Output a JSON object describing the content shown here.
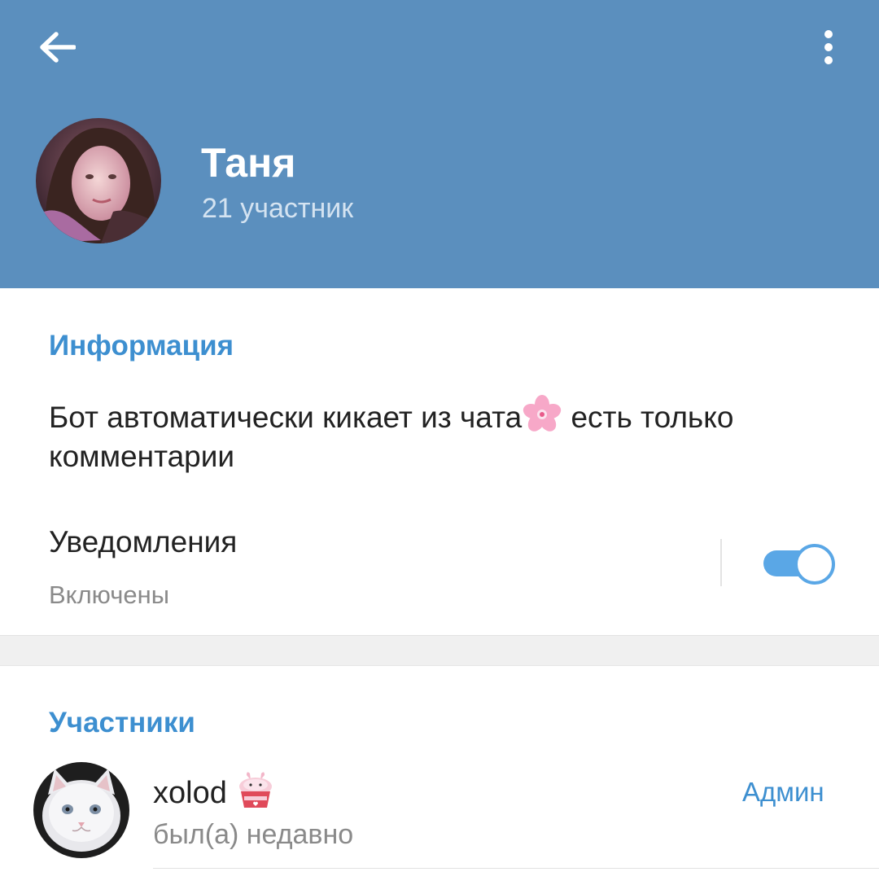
{
  "header": {
    "background_color": "#5b8fbe",
    "back_icon": "arrow-left-icon",
    "menu_icon": "more-vertical-icon",
    "title": "Таня",
    "subtitle": "21 участник"
  },
  "info": {
    "section_title": "Информация",
    "description_part1": "Бот автоматически кикает из чата",
    "description_emoji": "cherry-blossom-emoji",
    "description_part2": " есть только комментарии"
  },
  "notifications": {
    "label": "Уведомления",
    "status": "Включены",
    "enabled": true,
    "accent_color": "#5aa7e6"
  },
  "members": {
    "section_title": "Участники",
    "items": [
      {
        "name": "xolod",
        "emoji": "cupcake-emoji",
        "status": "был(а) недавно",
        "role": "Админ",
        "avatar": "white-kitten-photo"
      }
    ]
  },
  "colors": {
    "section_title": "#3d8fd0",
    "primary_text": "#222222",
    "secondary_text": "#8a8a8a"
  }
}
